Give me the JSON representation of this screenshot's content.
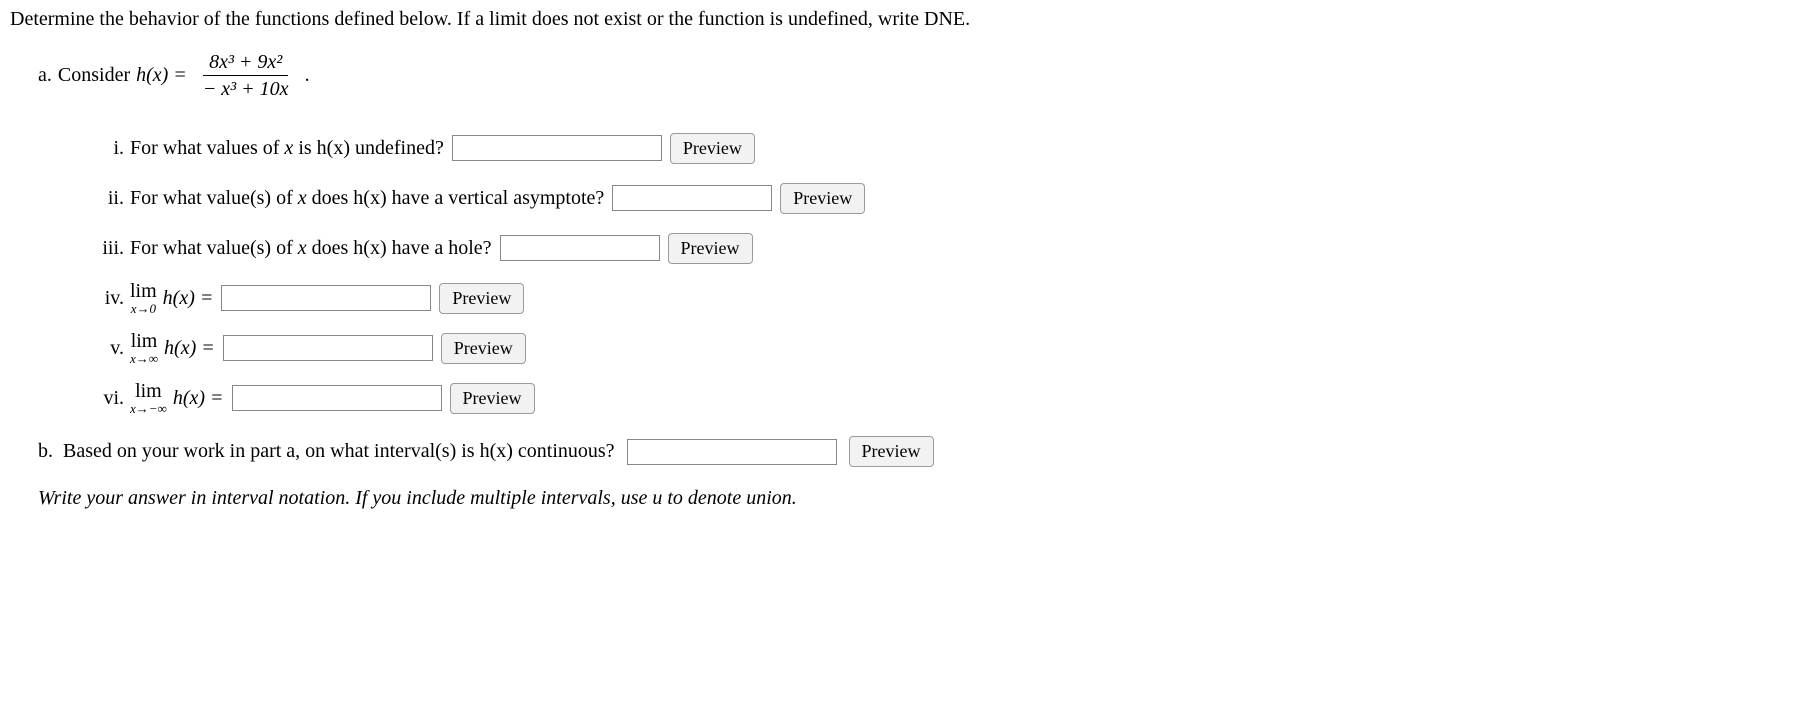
{
  "intro": "Determine the behavior of the functions defined below. If a limit does not exist or the function is undefined, write DNE.",
  "partA": {
    "label": "a.",
    "consider_prefix": "Consider ",
    "func_lhs": "h(x) = ",
    "numerator": "8x³ + 9x²",
    "denominator": "− x³ + 10x",
    "period": ".",
    "items": {
      "i": {
        "num": "i.",
        "text_before": "For what values of ",
        "var": "x",
        "text_after": " is h(x) undefined?"
      },
      "ii": {
        "num": "ii.",
        "text_before": "For what value(s) of ",
        "var": "x",
        "text_after": " does h(x) have a vertical asymptote?"
      },
      "iii": {
        "num": "iii.",
        "text_before": "For what value(s) of ",
        "var": "x",
        "text_after": " does h(x) have a hole?"
      },
      "iv": {
        "num": "iv.",
        "lim": "lim",
        "approach": "x→0",
        "rhs": "h(x) = "
      },
      "v": {
        "num": "v.",
        "lim": "lim",
        "approach": "x→∞",
        "rhs": "h(x) = "
      },
      "vi": {
        "num": "vi.",
        "lim": "lim",
        "approach": "x→−∞",
        "rhs": "h(x) = "
      }
    }
  },
  "partB": {
    "label": "b.",
    "text": "Based on your work in part a, on what interval(s) is h(x) continuous?"
  },
  "hint": "Write your answer in interval notation. If you include multiple intervals, use u to denote union.",
  "preview_label": "Preview"
}
